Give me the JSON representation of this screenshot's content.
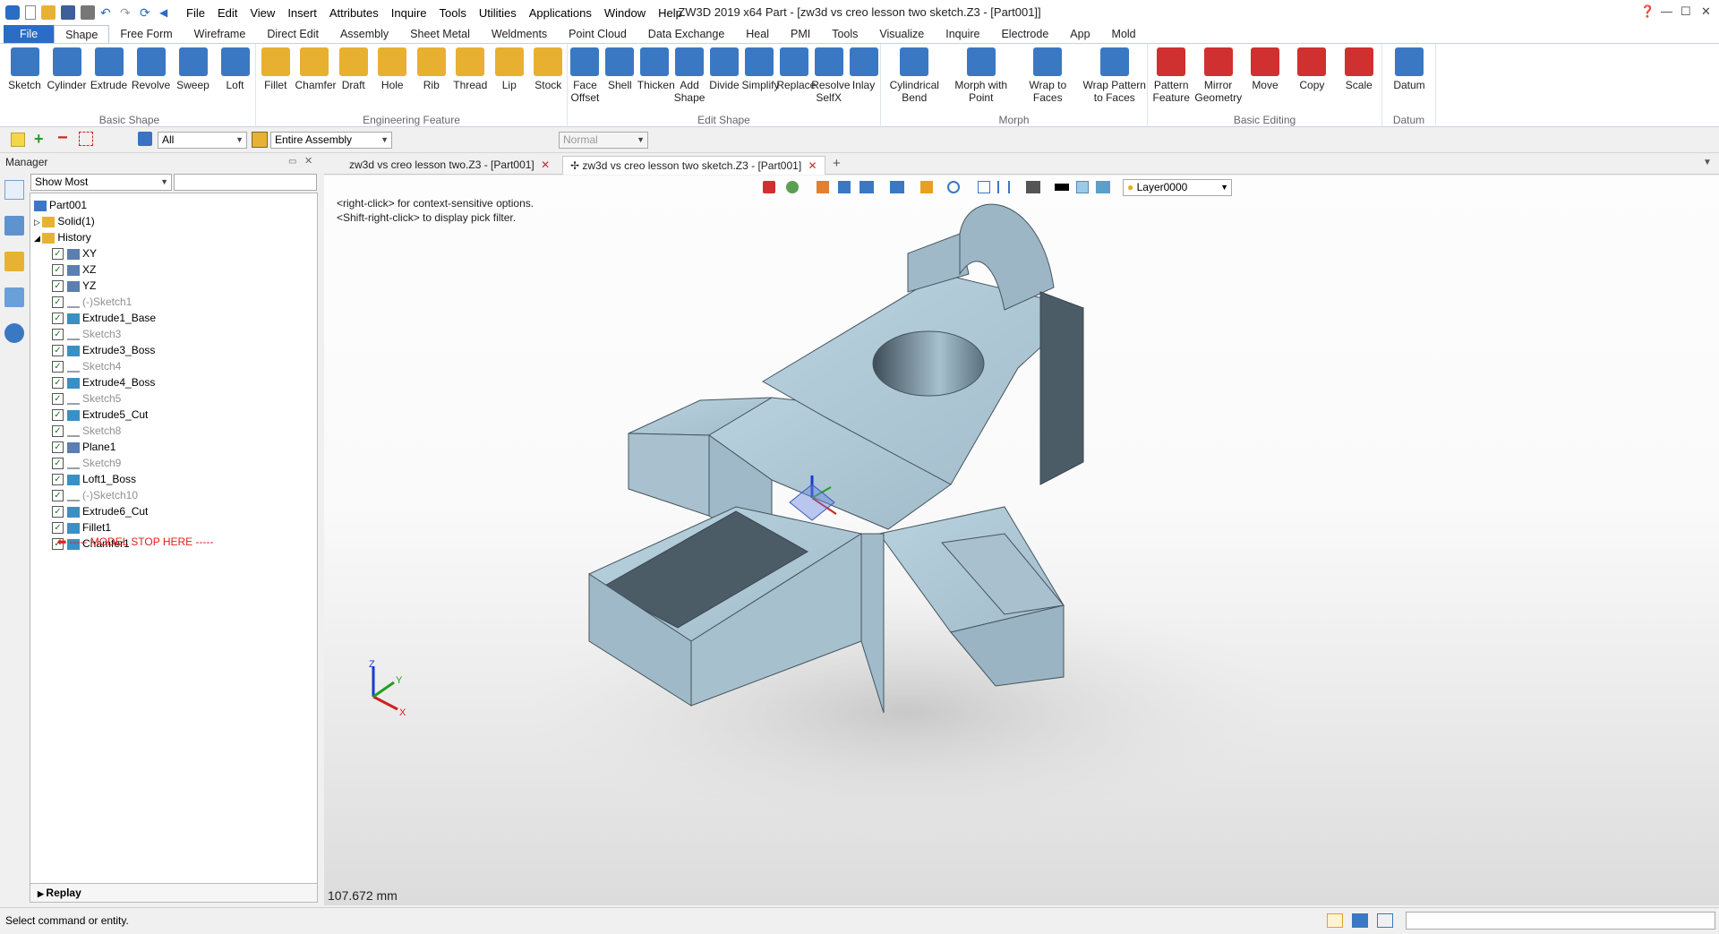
{
  "titlebar": {
    "menus": [
      "File",
      "Edit",
      "View",
      "Insert",
      "Attributes",
      "Inquire",
      "Tools",
      "Utilities",
      "Applications",
      "Window",
      "Help"
    ],
    "app_title": "ZW3D 2019  x64        Part - [zw3d vs creo lesson two sketch.Z3 - [Part001]]"
  },
  "ribbon_tabs": [
    "File",
    "Shape",
    "Free Form",
    "Wireframe",
    "Direct Edit",
    "Assembly",
    "Sheet Metal",
    "Weldments",
    "Point Cloud",
    "Data Exchange",
    "Heal",
    "PMI",
    "Tools",
    "Visualize",
    "Inquire",
    "Electrode",
    "App",
    "Mold"
  ],
  "ribbon": {
    "groups": [
      {
        "label": "Basic Shape",
        "buttons": [
          "Sketch",
          "Cylinder",
          "Extrude",
          "Revolve",
          "Sweep",
          "Loft"
        ]
      },
      {
        "label": "Engineering Feature",
        "buttons": [
          "Fillet",
          "Chamfer",
          "Draft",
          "Hole",
          "Rib",
          "Thread",
          "Lip",
          "Stock"
        ]
      },
      {
        "label": "Edit Shape",
        "buttons": [
          "Face Offset",
          "Shell",
          "Thicken",
          "Add Shape",
          "Divide",
          "Simplify",
          "Replace",
          "Resolve SelfX",
          "Inlay"
        ]
      },
      {
        "label": "Morph",
        "buttons": [
          "Cylindrical Bend",
          "Morph with Point",
          "Wrap to Faces",
          "Wrap Pattern to Faces"
        ]
      },
      {
        "label": "Basic Editing",
        "buttons": [
          "Pattern Feature",
          "Mirror Geometry",
          "Move",
          "Copy",
          "Scale"
        ]
      },
      {
        "label": "Datum",
        "buttons": [
          "Datum"
        ]
      }
    ]
  },
  "toolbar2": {
    "filter": "All",
    "scope": "Entire Assembly",
    "mode": "Normal"
  },
  "manager": {
    "title": "Manager",
    "show_combo": "Show Most",
    "replay": "Replay",
    "tree": [
      {
        "label": "Part001",
        "level": 0,
        "kind": "part"
      },
      {
        "label": "Solid(1)",
        "level": 1,
        "kind": "folder"
      },
      {
        "label": "History",
        "level": 1,
        "kind": "folder"
      },
      {
        "label": "XY",
        "level": 2,
        "kind": "plane",
        "grey": false
      },
      {
        "label": "XZ",
        "level": 2,
        "kind": "plane",
        "grey": false
      },
      {
        "label": "YZ",
        "level": 2,
        "kind": "plane",
        "grey": false
      },
      {
        "label": "(-)Sketch1",
        "level": 2,
        "kind": "sketch",
        "grey": true
      },
      {
        "label": "Extrude1_Base",
        "level": 2,
        "kind": "solid",
        "grey": false
      },
      {
        "label": "Sketch3",
        "level": 2,
        "kind": "sketch",
        "grey": true
      },
      {
        "label": "Extrude3_Boss",
        "level": 2,
        "kind": "solid",
        "grey": false
      },
      {
        "label": "Sketch4",
        "level": 2,
        "kind": "sketch",
        "grey": true
      },
      {
        "label": "Extrude4_Boss",
        "level": 2,
        "kind": "solid",
        "grey": false
      },
      {
        "label": "Sketch5",
        "level": 2,
        "kind": "sketch",
        "grey": true
      },
      {
        "label": "Extrude5_Cut",
        "level": 2,
        "kind": "solid",
        "grey": false
      },
      {
        "label": "Sketch8",
        "level": 2,
        "kind": "sketch",
        "grey": true
      },
      {
        "label": "Plane1",
        "level": 2,
        "kind": "plane",
        "grey": false
      },
      {
        "label": "Sketch9",
        "level": 2,
        "kind": "sketch",
        "grey": true
      },
      {
        "label": "Loft1_Boss",
        "level": 2,
        "kind": "solid",
        "grey": false
      },
      {
        "label": "(-)Sketch10",
        "level": 2,
        "kind": "sketch",
        "grey": true
      },
      {
        "label": "Extrude6_Cut",
        "level": 2,
        "kind": "solid",
        "grey": false
      },
      {
        "label": "Fillet1",
        "level": 2,
        "kind": "solid",
        "grey": false
      },
      {
        "label": "Chamfer1",
        "level": 2,
        "kind": "solid",
        "grey": false
      }
    ],
    "stop_marker": "----- MODEL STOP HERE -----"
  },
  "doc_tabs": [
    "zw3d vs creo lesson two.Z3 - [Part001]",
    "zw3d vs creo lesson two sketch.Z3 - [Part001]"
  ],
  "viewport": {
    "hint1": "<right-click> for context-sensitive options.",
    "hint2": "<Shift-right-click> to display pick filter.",
    "layer": "Layer0000",
    "scale": "107.672 mm",
    "axis_labels": [
      "Z",
      "Y",
      "X"
    ]
  },
  "status": {
    "text": "Select command or entity."
  },
  "colors": {
    "accent": "#2b6cc4",
    "model": "#a8c3d3",
    "model_dark": "#4a5b66",
    "stop": "#e02020"
  }
}
